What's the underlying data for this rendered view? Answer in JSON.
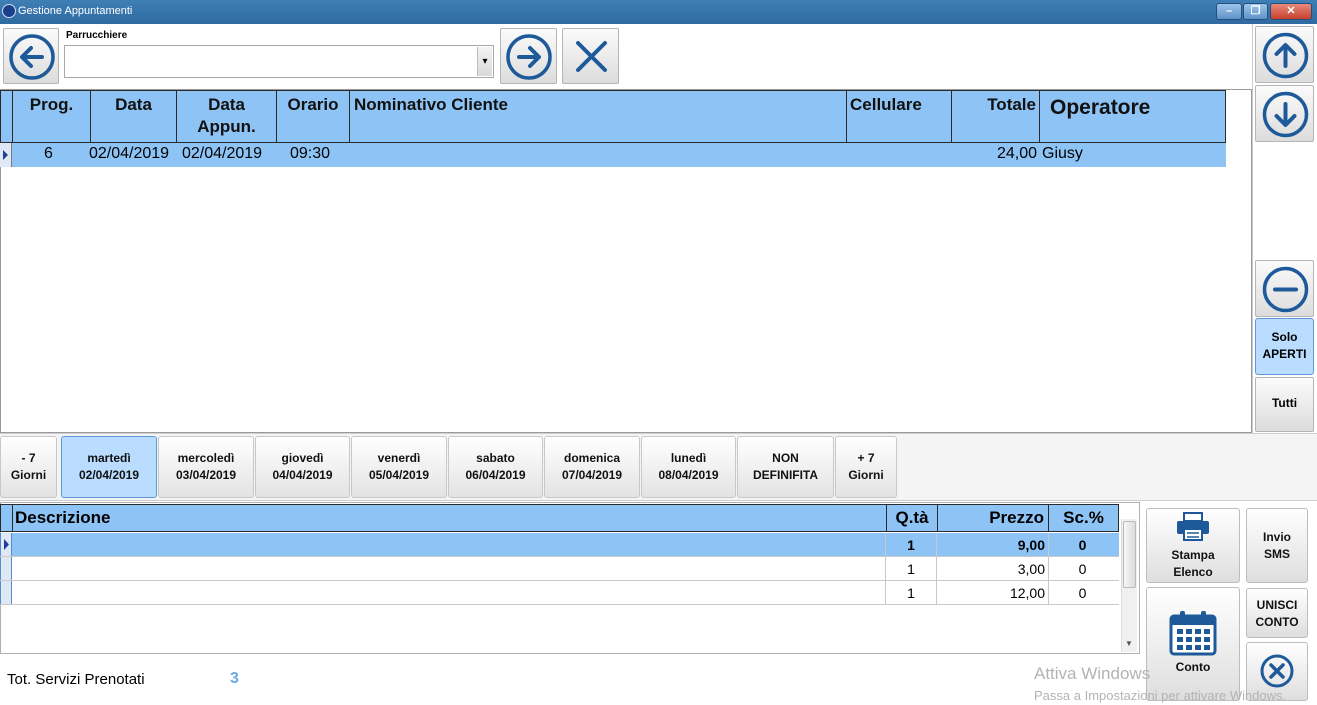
{
  "window": {
    "title": "Gestione Appuntamenti",
    "min_glyph": "–",
    "max_glyph": "❐",
    "close_glyph": "✕"
  },
  "toolbar": {
    "parrucchiere_label": "Parrucchiere",
    "parrucchiere_value": "",
    "dropdown_arrow": "▾"
  },
  "grid": {
    "columns": [
      "Prog.",
      "Data",
      "Data Appun.",
      "Orario",
      "Nominativo Cliente",
      "Cellulare",
      "Totale",
      "Operatore"
    ],
    "columns_split": {
      "data_appun_1": "Data",
      "data_appun_2": "Appun."
    },
    "rows": [
      {
        "prog": "6",
        "data": "02/04/2019",
        "data_appun": "02/04/2019",
        "orario": "09:30",
        "cliente": "",
        "cellulare": "",
        "totale": "24,00",
        "operatore": "Giusy"
      }
    ]
  },
  "right_panel": {
    "solo_aperti_1": "Solo",
    "solo_aperti_2": "APERTI",
    "tutti": "Tutti"
  },
  "day_tabs": [
    {
      "line1": "- 7",
      "line2": "Giorni",
      "selected": false
    },
    {
      "line1": "martedì",
      "line2": "02/04/2019",
      "selected": true
    },
    {
      "line1": "mercoledì",
      "line2": "03/04/2019",
      "selected": false
    },
    {
      "line1": "giovedì",
      "line2": "04/04/2019",
      "selected": false
    },
    {
      "line1": "venerdì",
      "line2": "05/04/2019",
      "selected": false
    },
    {
      "line1": "sabato",
      "line2": "06/04/2019",
      "selected": false
    },
    {
      "line1": "domenica",
      "line2": "07/04/2019",
      "selected": false
    },
    {
      "line1": "lunedì",
      "line2": "08/04/2019",
      "selected": false
    },
    {
      "line1": "NON",
      "line2": "DEFINIFITA",
      "selected": false
    },
    {
      "line1": "+ 7",
      "line2": "Giorni",
      "selected": false
    }
  ],
  "services": {
    "columns": [
      "Descrizione",
      "Q.tà",
      "Prezzo",
      "Sc.%"
    ],
    "rows": [
      {
        "descrizione": "",
        "qta": "1",
        "prezzo": "9,00",
        "sconto": "0"
      },
      {
        "descrizione": "",
        "qta": "1",
        "prezzo": "3,00",
        "sconto": "0"
      },
      {
        "descrizione": "",
        "qta": "1",
        "prezzo": "12,00",
        "sconto": "0"
      }
    ]
  },
  "actions": {
    "stampa_1": "Stampa",
    "stampa_2": "Elenco",
    "invio_1": "Invio",
    "invio_2": "SMS",
    "unisci_1": "UNISCI",
    "unisci_2": "CONTO",
    "conto": "Conto"
  },
  "footer": {
    "tot_label": "Tot. Servizi Prenotati",
    "tot_value": "3",
    "watermark_1": "Attiva Windows",
    "watermark_2": "Passa a Impostazioni per attivare Windows."
  },
  "colors": {
    "header_blue": "#8ec4f5",
    "selected_row": "#8ec4f5",
    "icon_blue": "#1e5a99"
  }
}
